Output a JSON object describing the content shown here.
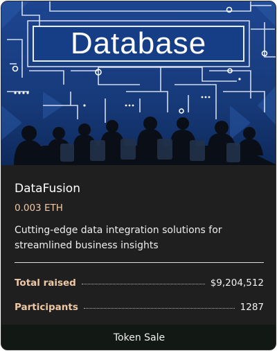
{
  "hero": {
    "banner_text": "Database",
    "image": "business-meeting-circuit-illustration"
  },
  "project": {
    "name": "DataFusion",
    "price": "0.003 ETH",
    "description": "Cutting-edge data integration solutions for streamlined business insights"
  },
  "stats": [
    {
      "label": "Total raised",
      "value": "$9,204,512"
    },
    {
      "label": "Participants",
      "value": "1287"
    }
  ],
  "footer": {
    "label": "Token Sale"
  },
  "colors": {
    "card_bg": "#1f1f1f",
    "accent": "#efc9a6",
    "footer_bg": "#121814",
    "hero_bg": "#1a3a78"
  }
}
